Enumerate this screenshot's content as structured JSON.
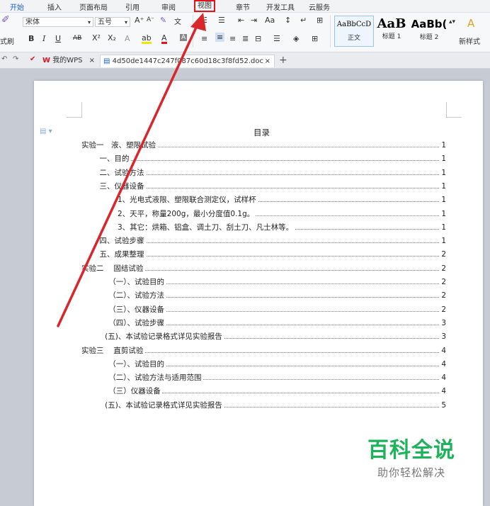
{
  "ribbon_tabs": [
    "开始",
    "插入",
    "页面布局",
    "引用",
    "审阅",
    "视图",
    "章节",
    "开发工具",
    "云服务"
  ],
  "ribbon": {
    "format_painter": "式刷",
    "font_name": "宋体",
    "font_size": "五号",
    "styles": [
      {
        "sample": "AaBbCcD",
        "name": "正文"
      },
      {
        "sample": "AaB",
        "name": "标题 1"
      },
      {
        "sample": "AaBb(",
        "name": "标题 2"
      }
    ],
    "new_style": "新样式"
  },
  "doc_tabs": {
    "wps_tab": "我的WPS",
    "file_tab": "4d50de1447c247f087c60d18c3f8fd52.doc",
    "close_symbol": "×",
    "add_symbol": "+"
  },
  "document": {
    "title": "目录",
    "toc": [
      {
        "text": "实验一　液、塑限试验",
        "page": "1",
        "indent": 0
      },
      {
        "text": "一、目的",
        "page": "1",
        "indent": 1
      },
      {
        "text": "二、试验方法",
        "page": "1",
        "indent": 1
      },
      {
        "text": "三、仪器设备",
        "page": "1",
        "indent": 1
      },
      {
        "text": "1、光电式液限、塑限联合测定仪，试样杯",
        "page": "1",
        "indent": 2
      },
      {
        "text": "2、天平，称量200g，最小分度值0.1g。",
        "page": "1",
        "indent": 2
      },
      {
        "text": "3、其它：烘箱、铝盒、调土刀、刮土刀、凡士林等。",
        "page": "1",
        "indent": 2
      },
      {
        "text": "四、试验步骤",
        "page": "1",
        "indent": 1
      },
      {
        "text": "五、成果整理",
        "page": "2",
        "indent": 1
      },
      {
        "text": "实验二　 固结试验",
        "page": "2",
        "indent": 0
      },
      {
        "text": "（一）、试验目的",
        "page": "2",
        "indent": 1.5
      },
      {
        "text": "（二）、试验方法",
        "page": "2",
        "indent": 1.5
      },
      {
        "text": "（三）、仪器设备",
        "page": "2",
        "indent": 1.5
      },
      {
        "text": "（四）、试验步骤",
        "page": "3",
        "indent": 1.5
      },
      {
        "text": "(五)、本试验记录格式详见实验报告",
        "page": "3",
        "indent": 1.3
      },
      {
        "text": "实验三　 直剪试验",
        "page": "4",
        "indent": 0
      },
      {
        "text": "（一）、试验目的",
        "page": "4",
        "indent": 1.5
      },
      {
        "text": "（二）、试验方法与适用范围",
        "page": "4",
        "indent": 1.5
      },
      {
        "text": "（三）仪器设备",
        "page": "4",
        "indent": 1.5
      },
      {
        "text": "(五)、本试验记录格式详见实验报告",
        "page": "5",
        "indent": 1.3
      }
    ]
  },
  "watermark": {
    "title": "百科全说",
    "subtitle": "助你轻松解决"
  },
  "colors": {
    "highlight_box": "#e0141e",
    "arrow": "#d9262b",
    "watermark_green": "#1db35a",
    "active_tab": "#1a64c8"
  }
}
